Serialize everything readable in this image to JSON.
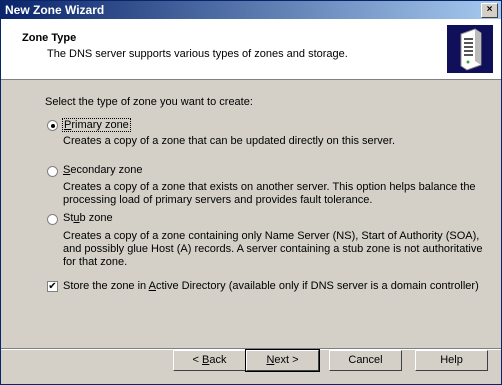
{
  "window": {
    "title": "New Zone Wizard",
    "close_glyph": "×"
  },
  "header": {
    "title": "Zone Type",
    "subtitle": "The DNS server supports various types of zones and storage."
  },
  "prompt": "Select the type of zone you want to create:",
  "options": [
    {
      "label": "Primary zone",
      "selected": true,
      "desc": "Creates a copy of a zone that can be updated directly on this server."
    },
    {
      "label": "Secondary zone",
      "selected": false,
      "desc": "Creates a copy of a zone that exists on another server. This option helps balance the processing load of primary servers and provides fault tolerance."
    },
    {
      "label": "Stub zone",
      "selected": false,
      "desc": "Creates a copy of a zone containing only Name Server (NS), Start of Authority (SOA), and possibly glue Host (A) records. A server containing a stub zone is not authoritative for that zone."
    }
  ],
  "ad_checkbox": {
    "label": "Store the zone in Active Directory (available only if DNS server is a domain controller)",
    "checked": true
  },
  "buttons": {
    "back": "< Back",
    "next": "Next >",
    "cancel": "Cancel",
    "help": "Help"
  },
  "icons": {
    "header_icon": "server-icon"
  }
}
